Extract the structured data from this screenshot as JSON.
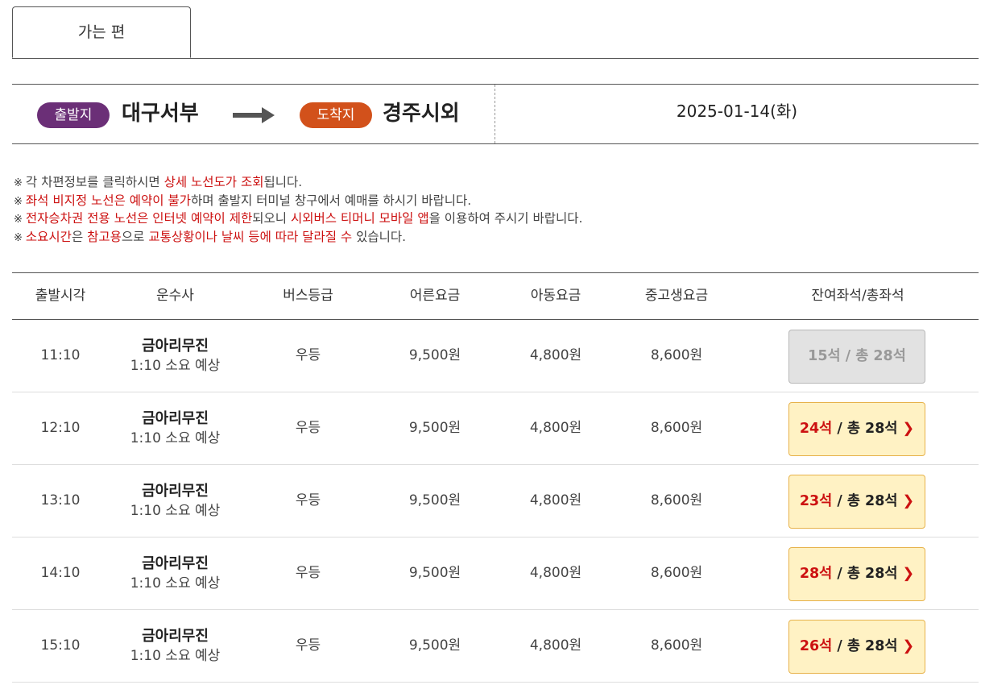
{
  "tab": {
    "label": "가는 편"
  },
  "route": {
    "departure_badge": "출발지",
    "departure": "대구서부",
    "arrival_badge": "도착지",
    "arrival": "경주시외",
    "date": "2025-01-14(화)"
  },
  "notices": [
    [
      {
        "t": "각 차편정보를 클릭하시면 ",
        "r": false
      },
      {
        "t": "상세 노선도가 조회",
        "r": true
      },
      {
        "t": "됩니다.",
        "r": false
      }
    ],
    [
      {
        "t": "좌석 비지정 노선은 예약이 불가",
        "r": true
      },
      {
        "t": "하며 출발지 터미널 창구에서 예매를 하시기 바랍니다.",
        "r": false
      }
    ],
    [
      {
        "t": "전자승차권 전용 노선은 인터넷 예약이 제한",
        "r": true
      },
      {
        "t": "되오니 ",
        "r": false
      },
      {
        "t": "시외버스 티머니 모바일 앱",
        "r": true
      },
      {
        "t": "을 이용하여 주시기 바랍니다.",
        "r": false
      }
    ],
    [
      {
        "t": "소요시간",
        "r": true
      },
      {
        "t": "은 ",
        "r": false
      },
      {
        "t": "참고용",
        "r": true
      },
      {
        "t": "으로 ",
        "r": false
      },
      {
        "t": "교통상황이나 날씨 등에 따라 달라질 수",
        "r": true
      },
      {
        "t": " 있습니다.",
        "r": false
      }
    ]
  ],
  "notice_mark": "※",
  "table": {
    "headers": [
      "출발시각",
      "운수사",
      "버스등급",
      "어른요금",
      "아동요금",
      "중고생요금",
      "잔여좌석/총좌석"
    ],
    "rows": [
      {
        "time": "11:10",
        "company": "금아리무진",
        "duration": "1:10 소요 예상",
        "grade": "우등",
        "adult": "9,500원",
        "child": "4,800원",
        "student": "8,600원",
        "available": "15석",
        "total": "총 28석",
        "enabled": false
      },
      {
        "time": "12:10",
        "company": "금아리무진",
        "duration": "1:10 소요 예상",
        "grade": "우등",
        "adult": "9,500원",
        "child": "4,800원",
        "student": "8,600원",
        "available": "24석",
        "total": "총 28석",
        "enabled": true
      },
      {
        "time": "13:10",
        "company": "금아리무진",
        "duration": "1:10 소요 예상",
        "grade": "우등",
        "adult": "9,500원",
        "child": "4,800원",
        "student": "8,600원",
        "available": "23석",
        "total": "총 28석",
        "enabled": true
      },
      {
        "time": "14:10",
        "company": "금아리무진",
        "duration": "1:10 소요 예상",
        "grade": "우등",
        "adult": "9,500원",
        "child": "4,800원",
        "student": "8,600원",
        "available": "28석",
        "total": "총 28석",
        "enabled": true
      },
      {
        "time": "15:10",
        "company": "금아리무진",
        "duration": "1:10 소요 예상",
        "grade": "우등",
        "adult": "9,500원",
        "child": "4,800원",
        "student": "8,600원",
        "available": "26석",
        "total": "총 28석",
        "enabled": true
      }
    ]
  },
  "colors": {
    "departure": "#6b2f77",
    "arrival": "#d2511b",
    "highlight": "#cc1111",
    "seat_bg": "#fff2c4"
  },
  "icons": {
    "route_arrow": "arrow-right-icon",
    "seat_chevron": "chevron-right-icon"
  }
}
